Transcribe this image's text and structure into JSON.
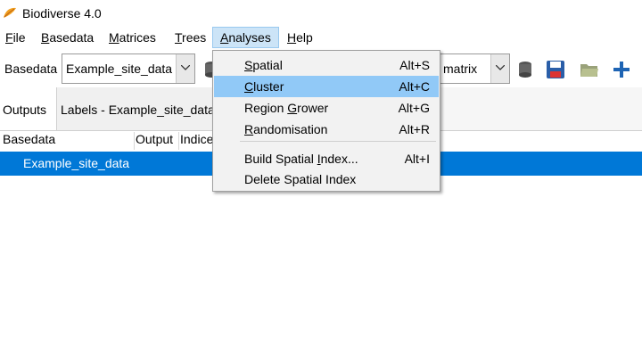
{
  "window": {
    "title": "Biodiverse 4.0"
  },
  "menubar": [
    {
      "label": "File",
      "mnemonic": "F",
      "rest": "ile"
    },
    {
      "label": "Basedata",
      "mnemonic": "B",
      "rest": "asedata"
    },
    {
      "label": "Matrices",
      "mnemonic": "M",
      "rest": "atrices"
    },
    {
      "label": "Trees",
      "mnemonic": "T",
      "rest": "rees"
    },
    {
      "label": "Analyses",
      "mnemonic": "A",
      "rest": "nalyses"
    },
    {
      "label": "Help",
      "mnemonic": "H",
      "rest": "elp"
    }
  ],
  "toolbar": {
    "basedata_label": "Basedata",
    "basedata_selected": "Example_site_data",
    "matrix_selected": "matrix"
  },
  "tabs": [
    {
      "label": "Outputs"
    },
    {
      "label": "Labels - Example_site_data"
    }
  ],
  "table": {
    "columns": [
      "Basedata",
      "Output",
      "Indice"
    ],
    "rows": [
      {
        "basedata": "Example_site_data"
      }
    ]
  },
  "analyses_menu": {
    "items": [
      {
        "pre": "",
        "mnemonic": "S",
        "post": "patial",
        "accel": "Alt+S"
      },
      {
        "pre": "",
        "mnemonic": "C",
        "post": "luster",
        "accel": "Alt+C",
        "highlighted": true
      },
      {
        "pre": "Region ",
        "mnemonic": "G",
        "post": "rower",
        "accel": "Alt+G"
      },
      {
        "pre": "",
        "mnemonic": "R",
        "post": "andomisation",
        "accel": "Alt+R"
      },
      {
        "pre": "Build Spatial ",
        "mnemonic": "I",
        "post": "ndex...",
        "accel": "Alt+I"
      },
      {
        "pre": "Delete Spatial Index",
        "mnemonic": "",
        "post": "",
        "accel": ""
      }
    ]
  },
  "colors": {
    "selection": "#0078d7",
    "menu_highlight": "#91c9f7",
    "menu_active": "#cce4f7"
  }
}
